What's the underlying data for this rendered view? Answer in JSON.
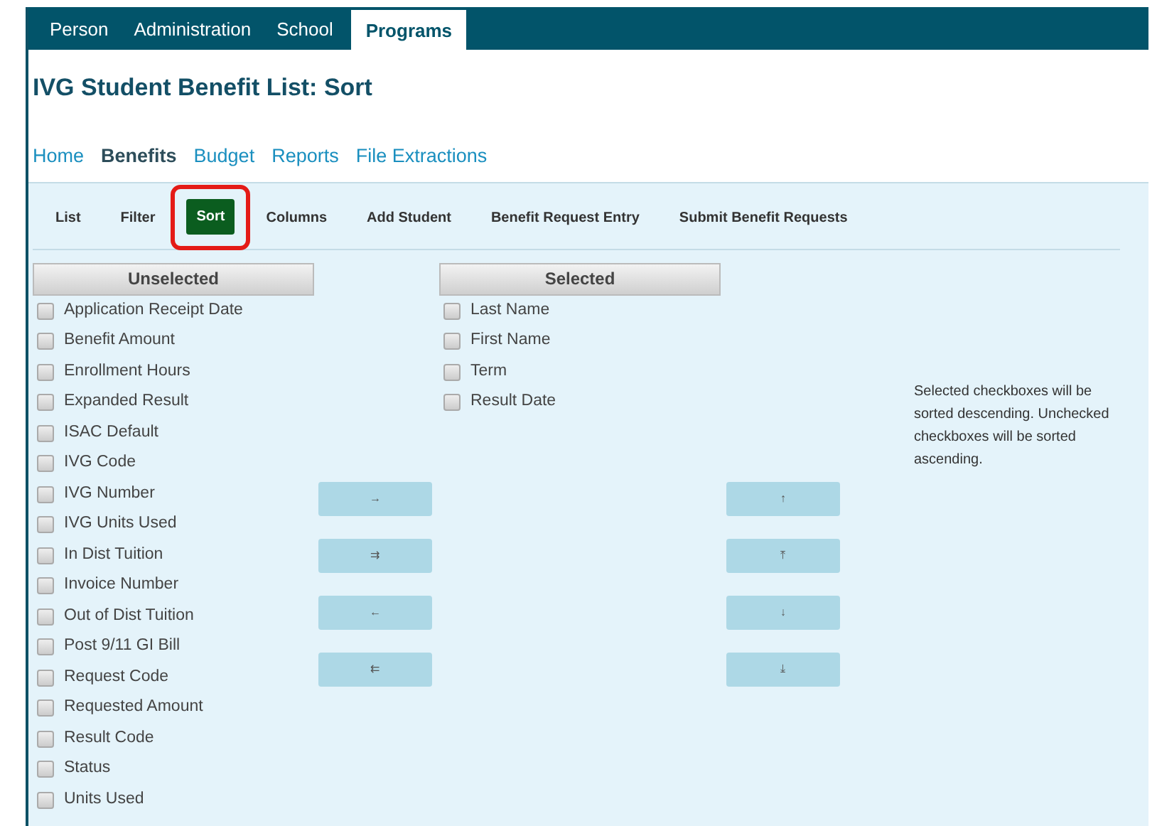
{
  "top_tabs": [
    {
      "label": "Person",
      "selected": false
    },
    {
      "label": "Administration",
      "selected": false
    },
    {
      "label": "School",
      "selected": false
    },
    {
      "label": "Programs",
      "selected": true
    }
  ],
  "page_title": "IVG Student Benefit List: Sort",
  "sub_nav": [
    {
      "label": "Home",
      "selected": false
    },
    {
      "label": "Benefits",
      "selected": true
    },
    {
      "label": "Budget",
      "selected": false
    },
    {
      "label": "Reports",
      "selected": false
    },
    {
      "label": "File Extractions",
      "selected": false
    }
  ],
  "toolbar": [
    {
      "label": "List",
      "selected": false,
      "highlighted": false
    },
    {
      "label": "Filter",
      "selected": false,
      "highlighted": false
    },
    {
      "label": "Sort",
      "selected": true,
      "highlighted": true
    },
    {
      "label": "Columns",
      "selected": false,
      "highlighted": false
    },
    {
      "label": "Add Student",
      "selected": false,
      "highlighted": false
    },
    {
      "label": "Benefit Request Entry",
      "selected": false,
      "highlighted": false
    },
    {
      "label": "Submit Benefit Requests",
      "selected": false,
      "highlighted": false
    }
  ],
  "unselected": {
    "header": "Unselected",
    "items": [
      {
        "label": "Application Receipt Date",
        "checked": false
      },
      {
        "label": "Benefit Amount",
        "checked": false
      },
      {
        "label": "Enrollment Hours",
        "checked": false
      },
      {
        "label": "Expanded Result",
        "checked": false
      },
      {
        "label": "ISAC Default",
        "checked": false
      },
      {
        "label": "IVG Code",
        "checked": false
      },
      {
        "label": "IVG Number",
        "checked": false
      },
      {
        "label": "IVG Units Used",
        "checked": false
      },
      {
        "label": "In Dist Tuition",
        "checked": false
      },
      {
        "label": "Invoice Number",
        "checked": false
      },
      {
        "label": "Out of Dist Tuition",
        "checked": false
      },
      {
        "label": "Post 9/11 GI Bill",
        "checked": false
      },
      {
        "label": "Request Code",
        "checked": false
      },
      {
        "label": "Requested Amount",
        "checked": false
      },
      {
        "label": "Result Code",
        "checked": false
      },
      {
        "label": "Status",
        "checked": false
      },
      {
        "label": "Units Used",
        "checked": false
      }
    ]
  },
  "move_buttons": [
    "→",
    "⇉",
    "←",
    "⇇"
  ],
  "selected": {
    "header": "Selected",
    "items": [
      {
        "label": "Last Name",
        "checked": false
      },
      {
        "label": "First Name",
        "checked": false
      },
      {
        "label": "Term",
        "checked": false
      },
      {
        "label": "Result Date",
        "checked": false
      }
    ]
  },
  "order_buttons": [
    "↑",
    "⤒",
    "↓",
    "⤓"
  ],
  "note": "Selected checkboxes will be sorted descending. Unchecked checkboxes will be sorted ascending."
}
